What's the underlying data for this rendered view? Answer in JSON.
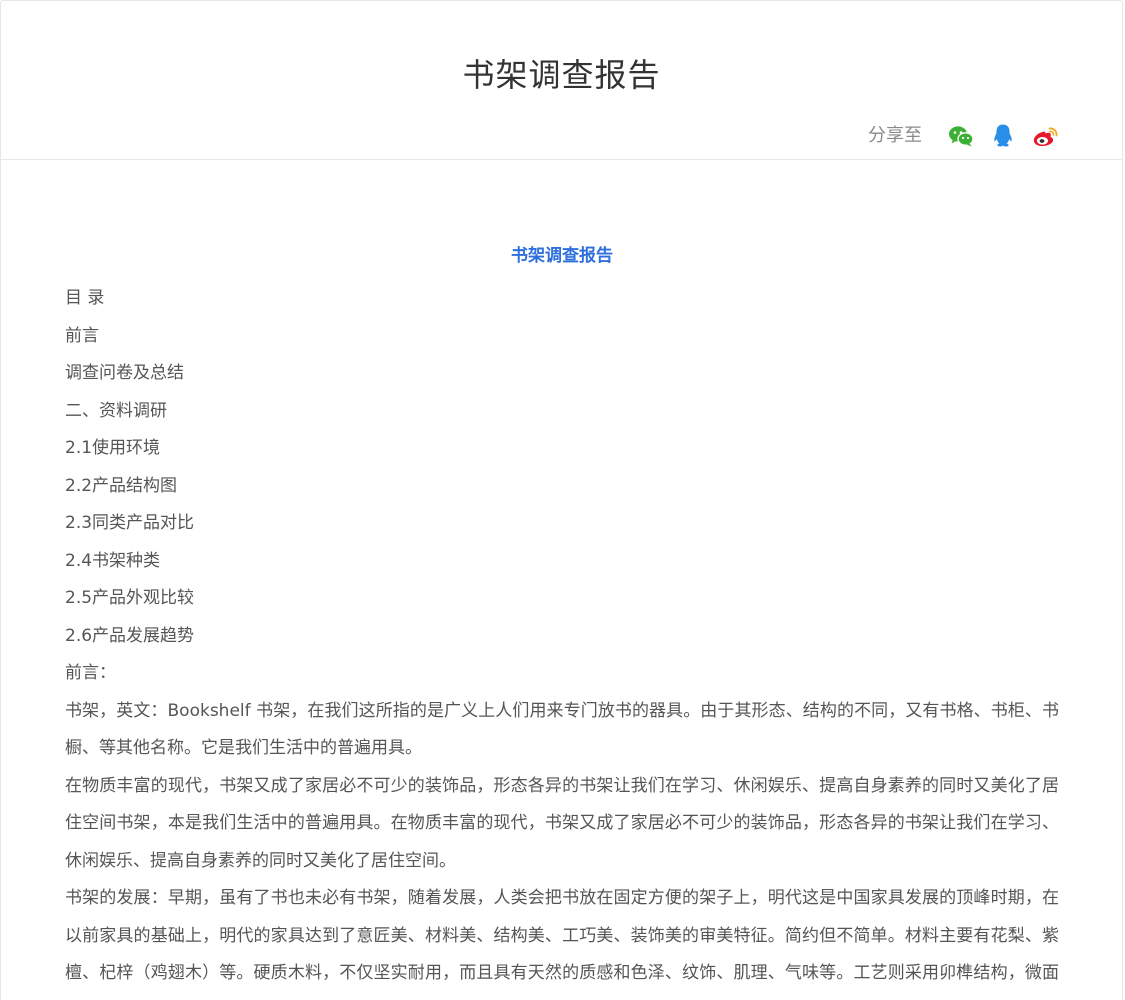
{
  "header": {
    "title": "书架调查报告",
    "share_label": "分享至",
    "share_icons": [
      "wechat-icon",
      "qq-icon",
      "weibo-icon"
    ],
    "colors": {
      "wechat": "#3cb034",
      "qq": "#2a8ee8",
      "weibo": "#e6162d",
      "heading_blue": "#2f6fdd"
    }
  },
  "document": {
    "heading": "书架调查报告",
    "toc": [
      "目 录",
      "前言",
      "调查问卷及总结",
      "二、资料调研",
      "2.1使用环境",
      "2.2产品结构图",
      "2.3同类产品对比",
      "2.4书架种类",
      "2.5产品外观比较",
      "2.6产品发展趋势",
      "前言："
    ],
    "paragraphs": [
      "书架，英文：Bookshelf 书架，在我们这所指的是广义上人们用来专门放书的器具。由于其形态、结构的不同，又有书格、书柜、书橱、等其他名称。它是我们生活中的普遍用具。",
      "在物质丰富的现代，书架又成了家居必不可少的装饰品，形态各异的书架让我们在学习、休闲娱乐、提高自身素养的同时又美化了居住空间书架，本是我们生活中的普遍用具。在物质丰富的现代，书架又成了家居必不可少的装饰品，形态各异的书架让我们在学习、休闲娱乐、提高自身素养的同时又美化了居住空间。",
      "书架的发展：早期，虽有了书也未必有书架，随着发展，人类会把书放在固定方便的架子上，明代这是中国家具发展的顶峰时期，在以前家具的基础上，明代的家具达到了意匠美、材料美、结构美、工巧美、装饰美的审美特征。简约但不简单。材料主要有花梨、紫檀、杞梓（鸡翅木）等。硬质木料，不仅坚实耐用，而且具有天然的质感和色泽、纹饰、肌理、气味等。工艺则采用卯榫结构，微面浅雕，线条点缀，装饰小面流美，使明式家具呈现出精美而简练、厚重、精巧、雅而宜纤巧，同此明式家具要亦仅是中国家具研究"
    ]
  }
}
